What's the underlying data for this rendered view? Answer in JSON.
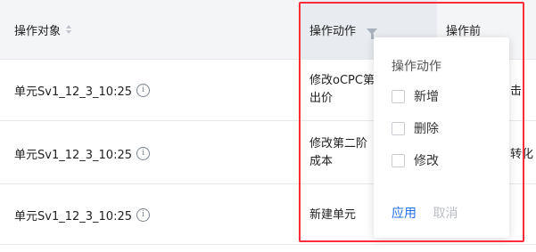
{
  "header": {
    "object_label": "操作对象",
    "action_label": "操作动作",
    "before_label": "操作前"
  },
  "rows": [
    {
      "object": "单元Sv1_12_3_10:25",
      "action": "修改oCPC第",
      "action_line2": "出价",
      "before": "击"
    },
    {
      "object": "单元Sv1_12_3_10:25",
      "action": "修改第二阶",
      "action_line2": "成本",
      "before": "转化"
    },
    {
      "object": "单元Sv1_12_3_10:25",
      "action": "新建单元",
      "action_line2": "",
      "before": ""
    }
  ],
  "info_icon_glyph": "i",
  "filter_popup": {
    "title": "操作动作",
    "options": [
      {
        "label": "新增",
        "checked": false
      },
      {
        "label": "删除",
        "checked": false
      },
      {
        "label": "修改",
        "checked": false
      }
    ],
    "apply_label": "应用",
    "cancel_label": "取消"
  },
  "colors": {
    "highlight": "#ff2d3a",
    "apply": "#1f6feb",
    "header_bg": "#f4f5f7"
  },
  "icons": [
    "sort-icon",
    "filter-icon",
    "info-icon"
  ]
}
